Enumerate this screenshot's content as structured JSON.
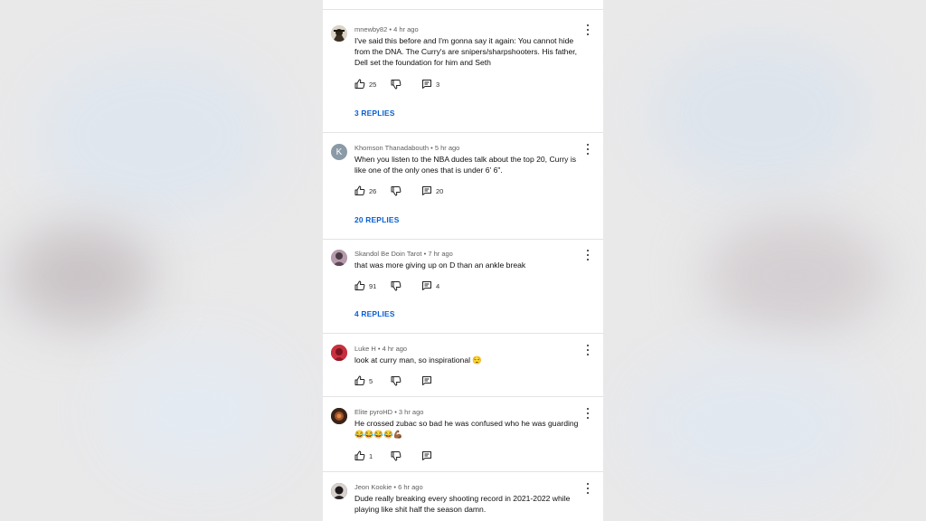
{
  "theme": {
    "link_color": "#065fd4",
    "text_color": "#0f0f0f",
    "meta_color": "#606060"
  },
  "comments": [
    {
      "author": "mnewby82",
      "time": "4 hr ago",
      "lines": [
        "I've said this before and I'm gonna say it again: You cannot hide",
        "from the DNA. The Curry's are snipers/sharpshooters. His father,",
        "Dell set the foundation for him and Seth"
      ],
      "likes": "25",
      "reply_count": "3",
      "replies_label": "3 REPLIES",
      "avatar": {
        "type": "photo",
        "color": "#2c2418"
      }
    },
    {
      "author": "Khomson Thanadabouth",
      "time": "5 hr ago",
      "lines": [
        "When you listen to the NBA dudes talk about the top 20,  Curry is",
        "like one of the only ones that is under 6' 6\"."
      ],
      "likes": "26",
      "reply_count": "20",
      "replies_label": "20 REPLIES",
      "avatar": {
        "type": "letter",
        "letter": "K",
        "color": "#8a9aa6"
      }
    },
    {
      "author": "Skandol Be Doin Tarot",
      "time": "7 hr ago",
      "lines": [
        "that was more giving up on D than an ankle break"
      ],
      "likes": "91",
      "reply_count": "4",
      "replies_label": "4 REPLIES",
      "avatar": {
        "type": "photo",
        "color": "#4a3a44"
      }
    },
    {
      "author": "Luke H",
      "time": "4 hr ago",
      "lines": [
        "look at curry man, so inspirational  😌"
      ],
      "likes": "5",
      "reply_count": "",
      "replies_label": "",
      "avatar": {
        "type": "photo",
        "color": "#b3283a"
      }
    },
    {
      "author": "Elite pyroHD",
      "time": "3 hr ago",
      "lines": [
        "He crossed zubac so bad he was confused who he was guarding",
        "😂😂😂😂💪🏾"
      ],
      "likes": "1",
      "reply_count": "",
      "replies_label": "",
      "avatar": {
        "type": "photo",
        "color": "#5a3320"
      }
    },
    {
      "author": "Jeon Kookie",
      "time": "6 hr ago",
      "lines": [
        "Dude really breaking every shooting record in 2021-2022 while",
        "playing like shit half the season damn."
      ],
      "likes": "",
      "reply_count": "",
      "replies_label": "",
      "avatar": {
        "type": "photo",
        "color": "#1e1a1c"
      }
    }
  ]
}
